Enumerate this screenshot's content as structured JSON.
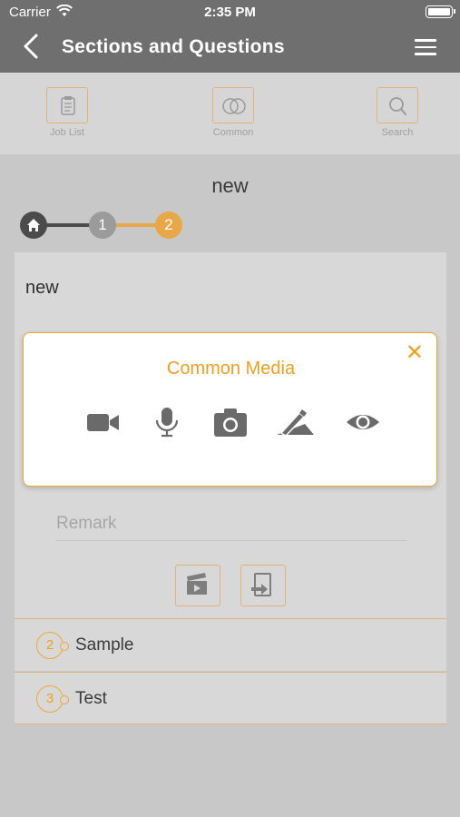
{
  "status_bar": {
    "carrier": "Carrier",
    "time": "2:35 PM"
  },
  "nav": {
    "title": "Sections and Questions",
    "back_icon": "chevron-left-icon",
    "menu_icon": "hamburger-menu-icon"
  },
  "toolbar": [
    {
      "label": "Job List",
      "icon": "clipboard-icon"
    },
    {
      "label": "Common",
      "icon": "overlap-circles-icon"
    },
    {
      "label": "Search",
      "icon": "search-icon"
    }
  ],
  "step_title": "new",
  "stepper": {
    "current_step": "2",
    "steps": [
      "1",
      "2"
    ],
    "colors": {
      "home": "#4b4b4b",
      "done": "#9b9b9b",
      "active": "#e8a84a"
    }
  },
  "card": {
    "title": "new",
    "remark_placeholder": "Remark"
  },
  "popup": {
    "title": "Common Media",
    "close": "✕",
    "media_icons": [
      "video-camera-icon",
      "microphone-icon",
      "photo-camera-icon",
      "signature-icon",
      "eye-icon"
    ]
  },
  "sections": [
    {
      "number": "2",
      "label": "Sample"
    },
    {
      "number": "3",
      "label": "Test"
    }
  ],
  "colors": {
    "accent": "#f0a020",
    "nav_bg": "#6f6f6f",
    "background": "#c8c8c8"
  }
}
